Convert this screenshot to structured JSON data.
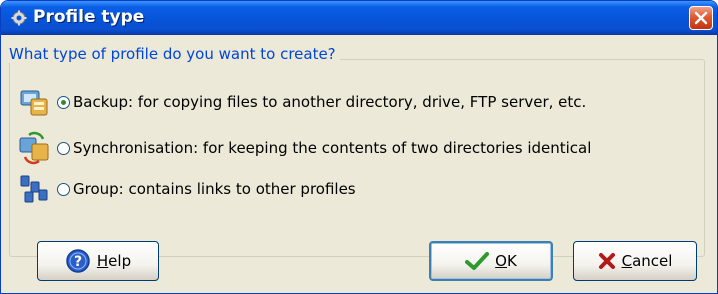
{
  "window": {
    "title": "Profile type"
  },
  "group": {
    "legend": "What type of profile do you want to create?"
  },
  "options": [
    {
      "label": "Backup: for copying files to another directory, drive, FTP server, etc.",
      "icon": "backup-icon",
      "selected": true
    },
    {
      "label": "Synchronisation: for keeping the contents of two directories identical",
      "icon": "sync-icon",
      "selected": false
    },
    {
      "label": "Group: contains links to other profiles",
      "icon": "group-icon",
      "selected": false
    }
  ],
  "buttons": {
    "help": {
      "mnemonic": "H",
      "rest": "elp"
    },
    "ok": {
      "mnemonic": "O",
      "rest": "K"
    },
    "cancel": {
      "mnemonic": "C",
      "rest": "ancel"
    }
  },
  "colors": {
    "titlebar": "#0754d8",
    "window_bg": "#ece9d8",
    "legend_text": "#0046d5",
    "close_button": "#e05a32",
    "ok_check": "#2e9a2e",
    "cancel_x": "#b01a1a"
  }
}
